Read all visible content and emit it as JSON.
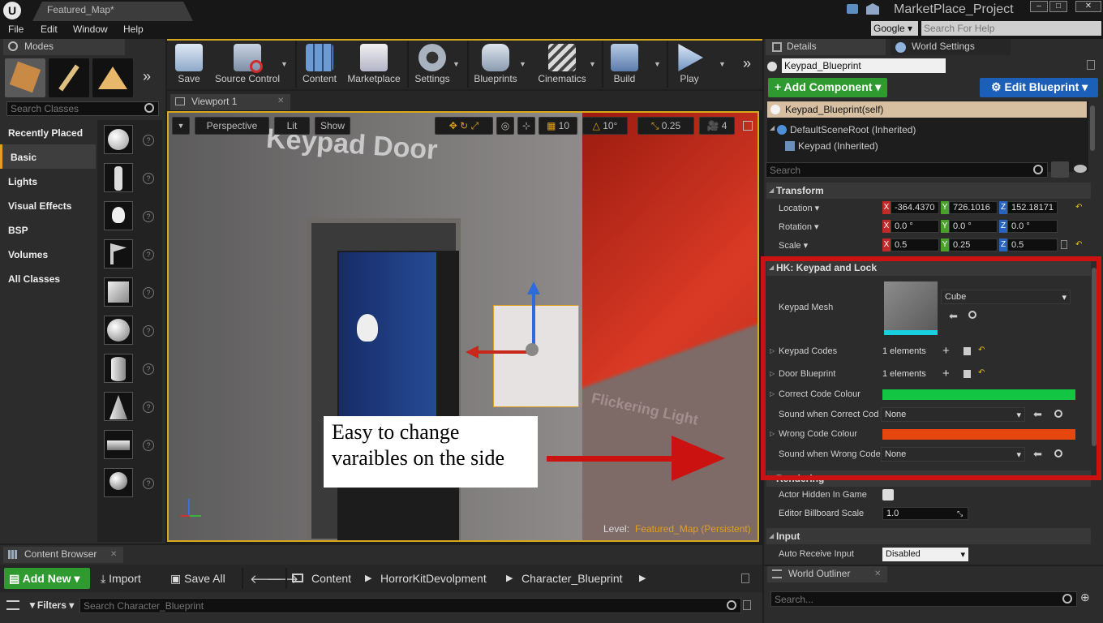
{
  "window": {
    "tab_title": "Featured_Map*",
    "project_name": "MarketPlace_Project",
    "search_engine": "Google",
    "search_help_placeholder": "Search For Help"
  },
  "menu": [
    "File",
    "Edit",
    "Window",
    "Help"
  ],
  "modes": {
    "tab_label": "Modes",
    "search_placeholder": "Search Classes",
    "categories": [
      "Recently Placed",
      "Basic",
      "Lights",
      "Visual Effects",
      "BSP",
      "Volumes",
      "All Classes"
    ],
    "selected_category": "Basic"
  },
  "toolbar": {
    "items": [
      "Save",
      "Source Control",
      "Content",
      "Marketplace",
      "Settings",
      "Blueprints",
      "Cinematics",
      "Build",
      "Play"
    ]
  },
  "viewport": {
    "tab_label": "Viewport 1",
    "perspective_label": "Perspective",
    "lit_label": "Lit",
    "show_label": "Show",
    "grid_snap": "10",
    "rot_snap": "10°",
    "scale_snap": "0.25",
    "camera_speed": "4",
    "sign_text": "Keypad Door",
    "floor_text": "Flickering Light",
    "level_label": "Level:",
    "level_value": "Featured_Map (Persistent)",
    "annotation_line1": "Easy to change",
    "annotation_line2": "varaibles on the side",
    "annotation_color": "#cc1111"
  },
  "details": {
    "tab_label": "Details",
    "world_settings_label": "World Settings",
    "actor_name": "Keypad_Blueprint",
    "add_component_label": "+ Add Component",
    "edit_blueprint_label": "Edit Blueprint",
    "components": [
      "Keypad_Blueprint(self)",
      "DefaultSceneRoot (Inherited)",
      "Keypad (Inherited)"
    ],
    "search_placeholder": "Search",
    "transform": {
      "header": "Transform",
      "location_label": "Location",
      "rotation_label": "Rotation",
      "scale_label": "Scale",
      "location": [
        "-364.4370",
        "726.1016",
        "152.18171"
      ],
      "rotation": [
        "0.0 °",
        "0.0 °",
        "0.0 °"
      ],
      "scale": [
        "0.5",
        "0.25",
        "0.5"
      ]
    },
    "keypad": {
      "header": "HK: Keypad and Lock",
      "mesh_label": "Keypad Mesh",
      "mesh_value": "Cube",
      "codes_label": "Keypad Codes",
      "codes_value": "1 elements",
      "door_label": "Door Blueprint",
      "door_value": "1 elements",
      "correct_colour_label": "Correct Code Colour",
      "correct_colour": "#12c542",
      "sound_correct_label": "Sound when Correct Cod",
      "sound_correct_value": "None",
      "wrong_colour_label": "Wrong Code Colour",
      "wrong_colour": "#e5470f",
      "sound_wrong_label": "Sound when Wrong Code",
      "sound_wrong_value": "None"
    },
    "rendering": {
      "header": "Rendering",
      "hidden_label": "Actor Hidden In Game",
      "billboard_label": "Editor Billboard Scale",
      "billboard_value": "1.0"
    },
    "input": {
      "header": "Input",
      "auto_receive_label": "Auto Receive Input",
      "auto_receive_value": "Disabled"
    }
  },
  "content_browser": {
    "tab_label": "Content Browser",
    "add_new_label": "Add New",
    "import_label": "Import",
    "save_all_label": "Save All",
    "breadcrumb": [
      "Content",
      "HorrorKitDevolpment",
      "Character_Blueprint"
    ],
    "filters_label": "Filters",
    "search_placeholder": "Search Character_Blueprint"
  },
  "world_outliner": {
    "tab_label": "World Outliner",
    "search_placeholder": "Search..."
  }
}
